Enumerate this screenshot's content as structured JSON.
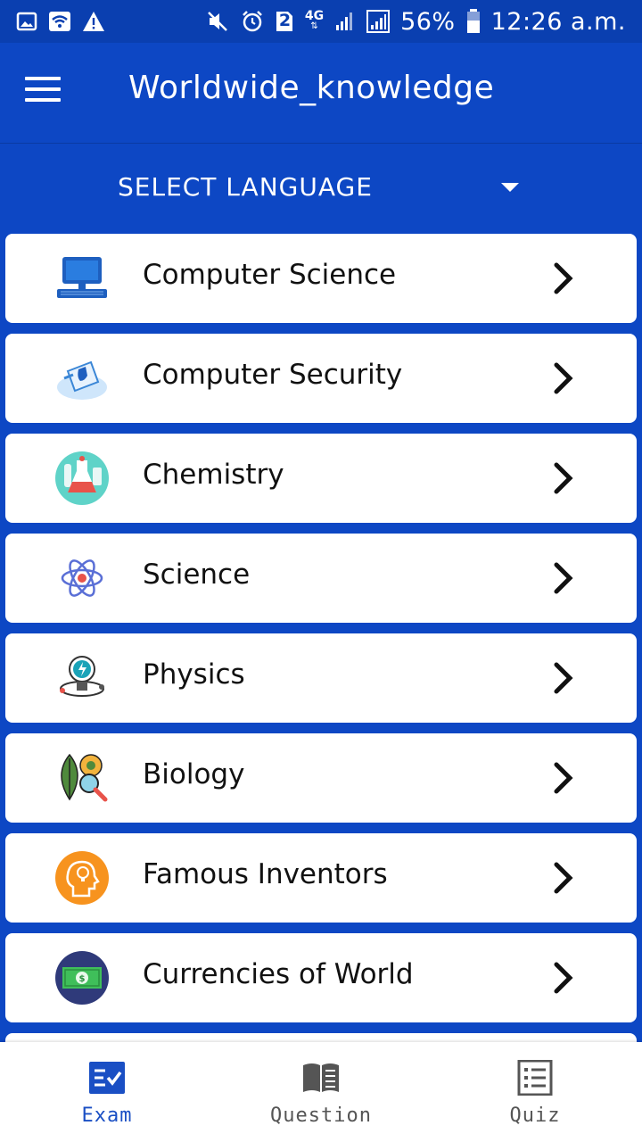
{
  "status_bar": {
    "left_icons": [
      "image-icon",
      "wifi-icon",
      "warning-icon"
    ],
    "right_icons": [
      "mute-icon",
      "alarm-icon",
      "sim-2-icon",
      "4g-icon",
      "signal-icon",
      "signal-icon",
      "battery-icon"
    ],
    "sim_number": "2",
    "network": "4G",
    "battery": "56%",
    "time": "12:26 a.m."
  },
  "app_bar": {
    "title": "Worldwide_knowledge",
    "menu_icon": "menu-icon"
  },
  "language": {
    "label": "SELECT LANGUAGE",
    "dropdown_icon": "dropdown-arrow-icon"
  },
  "categories": [
    {
      "label": "Computer Science",
      "icon": "computer-icon"
    },
    {
      "label": "Computer Security",
      "icon": "security-icon"
    },
    {
      "label": "Chemistry",
      "icon": "chemistry-flask-icon"
    },
    {
      "label": "Science",
      "icon": "atom-icon"
    },
    {
      "label": "Physics",
      "icon": "physics-bulb-icon"
    },
    {
      "label": "Biology",
      "icon": "biology-leaf-icon"
    },
    {
      "label": "Famous Inventors",
      "icon": "inventor-head-icon"
    },
    {
      "label": "Currencies of World",
      "icon": "currency-icon"
    }
  ],
  "bottom_nav": {
    "items": [
      {
        "label": "Exam",
        "icon": "exam-icon",
        "active": true
      },
      {
        "label": "Question",
        "icon": "book-icon",
        "active": false
      },
      {
        "label": "Quiz",
        "icon": "quiz-list-icon",
        "active": false
      }
    ],
    "active_color": "#1a4fc4",
    "inactive_color": "#555555"
  },
  "colors": {
    "primary": "#0d47c4",
    "status_bar": "#0a3fb0"
  }
}
